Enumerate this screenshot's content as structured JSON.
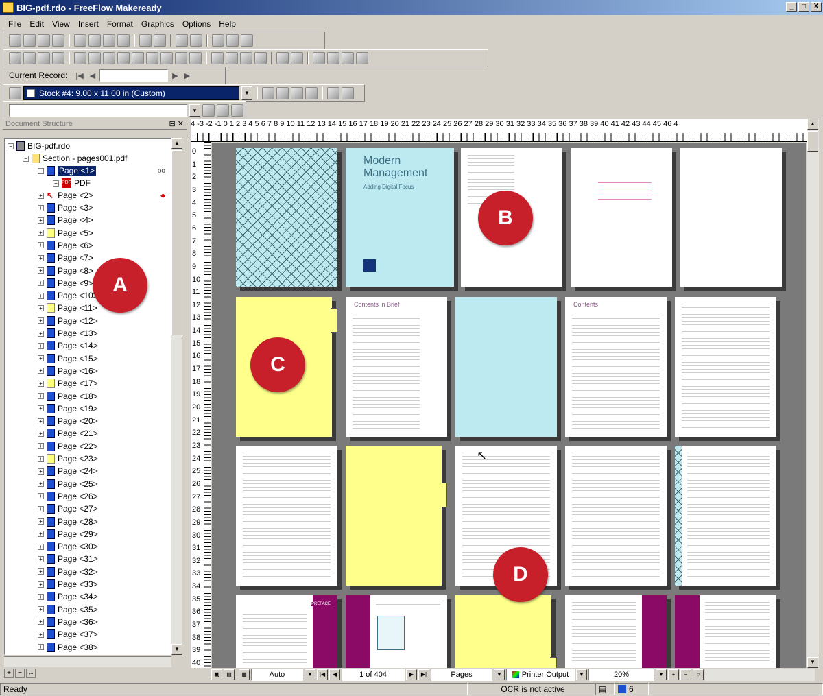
{
  "window": {
    "title": "BIG-pdf.rdo - FreeFlow Makeready",
    "min": "_",
    "max": "□",
    "close": "X"
  },
  "menu": [
    "File",
    "Edit",
    "View",
    "Insert",
    "Format",
    "Graphics",
    "Options",
    "Help"
  ],
  "record_bar": {
    "label": "Current Record:",
    "value": ""
  },
  "stock": {
    "label": "Stock #4: 9.00 x 11.00 in (Custom)"
  },
  "doc_panel": {
    "title": "Document Structure"
  },
  "tree": {
    "root": "BIG-pdf.rdo",
    "section": "Section - pages001.pdf",
    "page1": "Page <1>",
    "pdf": "PDF",
    "page2": "Page <2>",
    "pages": [
      "Page <3>",
      "Page <4>",
      "Page <5>",
      "Page <6>",
      "Page <7>",
      "Page <8>",
      "Page <9>",
      "Page <10>",
      "Page <11>",
      "Page <12>",
      "Page <13>",
      "Page <14>",
      "Page <15>",
      "Page <16>",
      "Page <17>",
      "Page <18>",
      "Page <19>",
      "Page <20>",
      "Page <21>",
      "Page <22>",
      "Page <23>",
      "Page <24>",
      "Page <25>",
      "Page <26>",
      "Page <27>",
      "Page <28>",
      "Page <29>",
      "Page <30>",
      "Page <31>",
      "Page <32>",
      "Page <33>",
      "Page <34>",
      "Page <35>",
      "Page <36>",
      "Page <37>",
      "Page <38>"
    ],
    "yellow_pages": [
      "Page <5>",
      "Page <11>",
      "Page <17>",
      "Page <23>"
    ]
  },
  "hruler": "4 -3 -2 -1 0 1 2 3 4 5 6 7 8 9 10 11 12 13 14 15 16 17 18 19 20 21 22 23 24 25 26 27 28 29 30 31 32 33 34 35 36 37 38 39 40 41 42 43 44 45 46 4",
  "vruler": [
    "0",
    "1",
    "2",
    "3",
    "4",
    "5",
    "6",
    "7",
    "8",
    "9",
    "10",
    "11",
    "12",
    "13",
    "14",
    "15",
    "16",
    "17",
    "18",
    "19",
    "20",
    "21",
    "22",
    "23",
    "24",
    "25",
    "26",
    "27",
    "28",
    "29",
    "30",
    "31",
    "32",
    "33",
    "34",
    "35",
    "36",
    "37",
    "38",
    "39",
    "40"
  ],
  "thumbs": {
    "mm_title": "Modern Management",
    "mm_sub": "Adding Digital Focus",
    "contents_brief": "Contents in Brief",
    "contents": "Contents",
    "preface": "PREFACE"
  },
  "markers": [
    "A",
    "B",
    "C",
    "D"
  ],
  "bottom": {
    "fit": "Auto",
    "page": "1 of 404",
    "mode": "Pages",
    "output": "Printer Output",
    "zoom": "20%"
  },
  "status": {
    "ready": "Ready",
    "ocr": "OCR is not active",
    "count": "6"
  },
  "colors": {
    "cyan": "#bdeaf0",
    "yellow": "#ffff8c",
    "purple": "#8b0a66",
    "marker": "#c8202a"
  }
}
